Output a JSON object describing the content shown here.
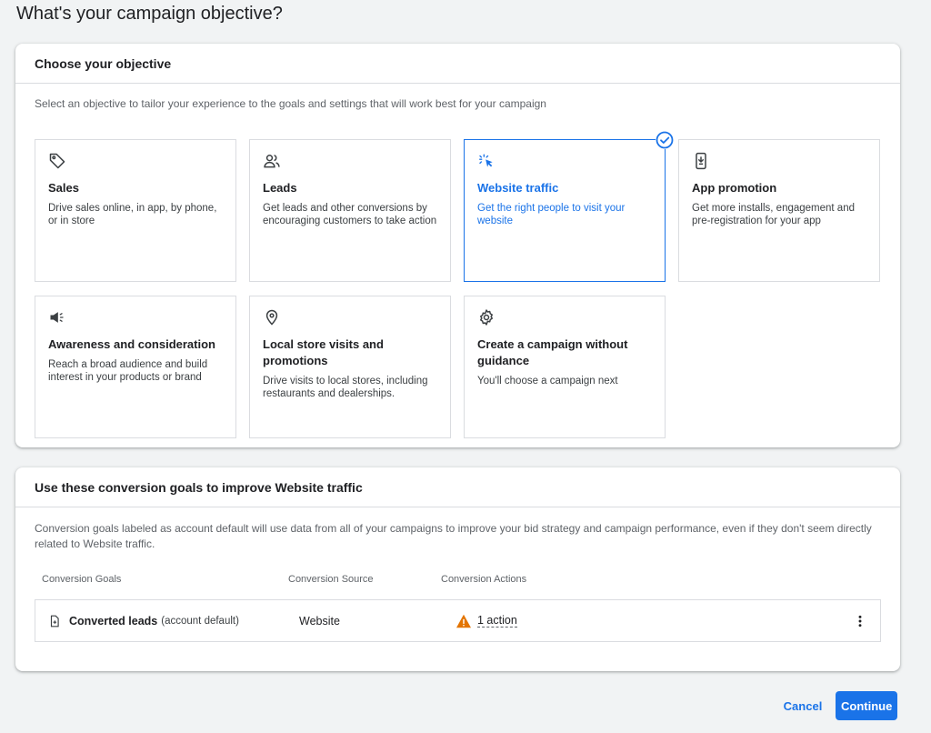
{
  "page": {
    "title": "What's your campaign objective?"
  },
  "objective_card": {
    "header": "Choose your objective",
    "description": "Select an objective to tailor your experience to the goals and settings that will work best for your campaign",
    "tiles": [
      {
        "icon": "tag-icon",
        "title": "Sales",
        "desc": "Drive sales online, in app, by phone, or in store",
        "selected": false
      },
      {
        "icon": "people-icon",
        "title": "Leads",
        "desc": "Get leads and other conversions by encouraging customers to take action",
        "selected": false
      },
      {
        "icon": "cursor-click-icon",
        "title": "Website traffic",
        "desc": "Get the right people to visit your website",
        "selected": true
      },
      {
        "icon": "phone-download-icon",
        "title": "App promotion",
        "desc": "Get more installs, engagement and pre-registration for your app",
        "selected": false
      },
      {
        "icon": "megaphone-icon",
        "title": "Awareness and consideration",
        "desc": "Reach a broad audience and build interest in your products or brand",
        "selected": false
      },
      {
        "icon": "location-pin-icon",
        "title": "Local store visits and promotions",
        "desc": "Drive visits to local stores, including restaurants and dealerships.",
        "selected": false
      },
      {
        "icon": "gear-icon",
        "title": "Create a campaign without guidance",
        "desc": "You'll choose a campaign next",
        "selected": false
      }
    ]
  },
  "goals_card": {
    "header": "Use these conversion goals to improve Website traffic",
    "description": "Conversion goals labeled as account default will use data from all of your campaigns to improve your bid strategy and campaign performance, even if they don't seem directly related to Website traffic.",
    "columns": [
      "Conversion Goals",
      "Conversion Source",
      "Conversion Actions"
    ],
    "rows": [
      {
        "goal": "Converted leads",
        "goal_suffix": "(account default)",
        "source": "Website",
        "actions": "1 action",
        "icon": "document-plus-icon",
        "warning_icon": "warning-icon",
        "menu_icon": "more-vert-icon"
      }
    ]
  },
  "footer": {
    "cancel_label": "Cancel",
    "continue_label": "Continue"
  },
  "colors": {
    "accent": "#1a73e8",
    "warning": "#e37400",
    "border": "#dadce0",
    "background": "#f1f3f4"
  }
}
